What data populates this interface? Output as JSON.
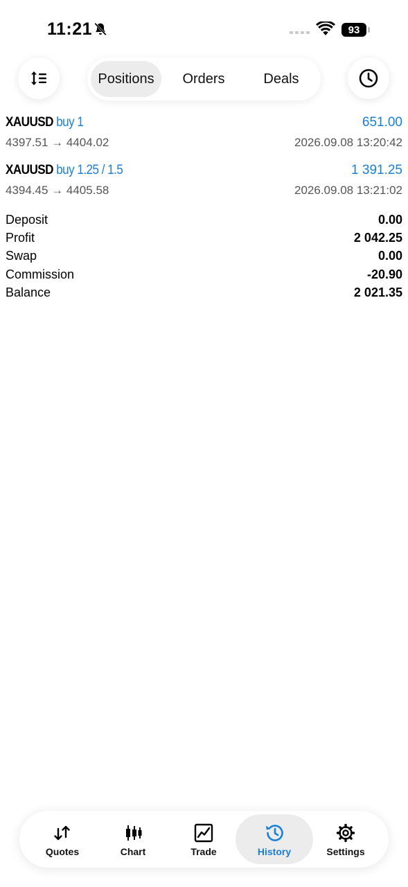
{
  "status_bar": {
    "time": "11:21",
    "battery": "93"
  },
  "toolbar": {
    "segments": [
      {
        "label": "Positions",
        "active": true
      },
      {
        "label": "Orders",
        "active": false
      },
      {
        "label": "Deals",
        "active": false
      }
    ],
    "left_icon": "sort-icon",
    "right_icon": "clock-icon"
  },
  "positions": [
    {
      "symbol": "XAUUSD",
      "side": "buy 1",
      "profit": "651.00",
      "prices": "4397.51 → 4404.02",
      "time": "2026.09.08 13:20:42"
    },
    {
      "symbol": "XAUUSD",
      "side": "buy 1.25 / 1.5",
      "profit": "1 391.25",
      "prices": "4394.45 → 4405.58",
      "time": "2026.09.08 13:21:02"
    }
  ],
  "summary": [
    {
      "label": "Deposit",
      "value": "0.00"
    },
    {
      "label": "Profit",
      "value": "2 042.25"
    },
    {
      "label": "Swap",
      "value": "0.00"
    },
    {
      "label": "Commission",
      "value": "-20.90"
    },
    {
      "label": "Balance",
      "value": "2 021.35"
    }
  ],
  "tabbar": {
    "items": [
      {
        "label": "Quotes",
        "icon": "quotes-icon"
      },
      {
        "label": "Chart",
        "icon": "candlestick-icon"
      },
      {
        "label": "Trade",
        "icon": "trade-icon"
      },
      {
        "label": "History",
        "icon": "history-icon",
        "active": true
      },
      {
        "label": "Settings",
        "icon": "gear-icon"
      }
    ]
  },
  "colors": {
    "accent": "#1a7fd6",
    "text": "#000000",
    "secondary_text": "#555555",
    "active_bg": "#ececec"
  }
}
